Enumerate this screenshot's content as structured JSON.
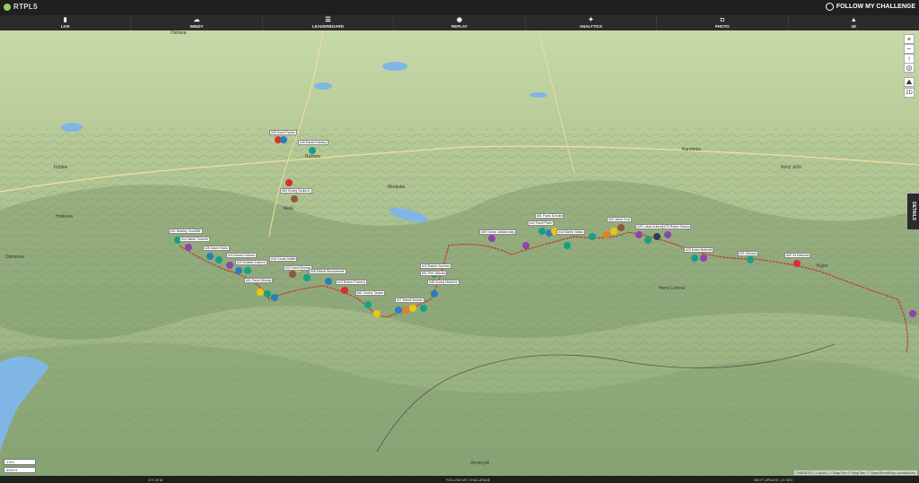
{
  "app": {
    "title": "RTPL5",
    "brand": "FOLLOW MY CHALLENGE"
  },
  "nav": [
    {
      "label": "LIVE",
      "icon": "map-icon"
    },
    {
      "label": "WINDY",
      "icon": "cloud-icon"
    },
    {
      "label": "LEADERBOARD",
      "icon": "list-icon"
    },
    {
      "label": "REPLAY",
      "icon": "replay-icon"
    },
    {
      "label": "ANALYTICS",
      "icon": "analytics-icon"
    },
    {
      "label": "PHOTO",
      "icon": "camera-icon"
    },
    {
      "label": "3D",
      "icon": "mountain-icon"
    }
  ],
  "map_controls": {
    "zoom_in": "+",
    "zoom_out": "−",
    "compass": "↑",
    "locate": "◎",
    "layers": "⛰",
    "mode": "2D"
  },
  "details_tab": "DETAILS",
  "scale": {
    "top": "1 km",
    "bottom": "5000 ft"
  },
  "footer": {
    "left": "0 H 20 M",
    "center": "FOLLOW MY CHALLENGE",
    "right": "NEXT UPDATE: 21 SEC"
  },
  "attribution": "©MESDZ0 | LAAA/LJ ©MapTiler © MapTiler © OpenStreetMap contributors",
  "places": [
    {
      "name": "Ostrava",
      "id": "ostrava"
    },
    {
      "name": "Rožnov",
      "id": "roznov"
    },
    {
      "name": "Ostravice",
      "id": "ostravice"
    },
    {
      "name": "Frýdek",
      "id": "frydek"
    },
    {
      "name": "Morávka",
      "id": "moravka"
    },
    {
      "name": "Malá",
      "id": "mala"
    },
    {
      "name": "Hrabová",
      "id": "hrabova"
    },
    {
      "name": "Horní Lomná",
      "id": "horni-lomna"
    },
    {
      "name": "Vendryně",
      "id": "vendryne"
    },
    {
      "name": "Karolinka",
      "id": "karolinka"
    },
    {
      "name": "Nový Jičín",
      "id": "novy-jicin"
    },
    {
      "name": "Kyjov",
      "id": "kyjov"
    }
  ],
  "pilot_labels": [
    "#05 Pavel Pavlus",
    "#45 Martin Kalusky",
    "#63 Ondrej Sedlovic",
    "#01 Bradley Goodliffe",
    "#14 Jakub Turanek",
    "#26 Adam Kubis",
    "#44 Marek Kubicek",
    "#20 Kolibek Kubicek",
    "#16 Tomas Mallet",
    "#02 Kamil Bednar",
    "#31 Pavel Zilinsky",
    "#08 Michal Stromasmek",
    "#13 Robert Pokorny",
    "#61 Ondrej Taraba",
    "#17 Marek Bodnar",
    "#10 Radek Vavrinec",
    "#51 Petr Valecka",
    "#48 Ondrej Martinek",
    "#69 Tomas Jankalovsky",
    "#81 Frank Schulte",
    "#42 Pavel Peter",
    "#44 Marek Vlasko",
    "#34 Jakub Kost",
    "#29 Lukas Kubicek",
    "#75 Radim Rauba",
    "#23 Kotes Bubenik",
    "#21 Kalusch",
    "#60 Vit Kalivoda"
  ],
  "colors": {
    "track": "#c0392b",
    "marker_purple": "#8e44ad",
    "marker_teal": "#16a085",
    "marker_blue": "#2980b9",
    "marker_red": "#d63031",
    "marker_orange": "#e67e22",
    "marker_yellow": "#f1c40f",
    "lake": "#7fb6e6"
  }
}
